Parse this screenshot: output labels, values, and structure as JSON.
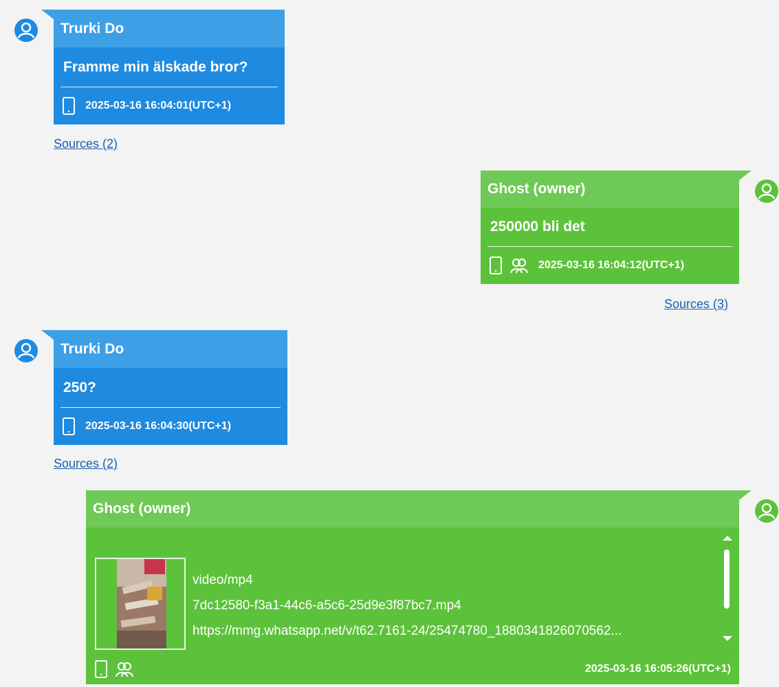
{
  "messages": [
    {
      "sender": "Trurki Do",
      "text": "Framme min älskade bror?",
      "timestamp": "2025-03-16 16:04:01(UTC+1)",
      "sources": "Sources (2)",
      "direction": "incoming",
      "icons": [
        "phone-icon"
      ]
    },
    {
      "sender": "Ghost (owner)",
      "text": "250000 bli det",
      "timestamp": "2025-03-16 16:04:12(UTC+1)",
      "sources": "Sources (3)",
      "direction": "outgoing",
      "icons": [
        "phone-icon",
        "group-icon"
      ]
    },
    {
      "sender": "Trurki Do",
      "text": "250?",
      "timestamp": "2025-03-16 16:04:30(UTC+1)",
      "sources": "Sources (2)",
      "direction": "incoming",
      "icons": [
        "phone-icon"
      ]
    },
    {
      "sender": "Ghost (owner)",
      "attachment": {
        "mime": "video/mp4",
        "filename": "7dc12580-f3a1-44c6-a5c6-25d9e3f87bc7.mp4",
        "url": "https://mmg.whatsapp.net/v/t62.7161-24/25474780_1880341826070562..."
      },
      "timestamp": "2025-03-16 16:05:26(UTC+1)",
      "direction": "outgoing",
      "icons": [
        "phone-icon",
        "group-icon"
      ]
    }
  ],
  "colors": {
    "incoming_body": "#1e8ae0",
    "incoming_header": "#3da0e6",
    "outgoing_body": "#5cc23b",
    "outgoing_header": "#6fc955",
    "avatar_incoming": "#1e8ae0",
    "avatar_outgoing": "#5cc23b",
    "link": "#1a5fb4",
    "background": "#f3f3f3"
  }
}
